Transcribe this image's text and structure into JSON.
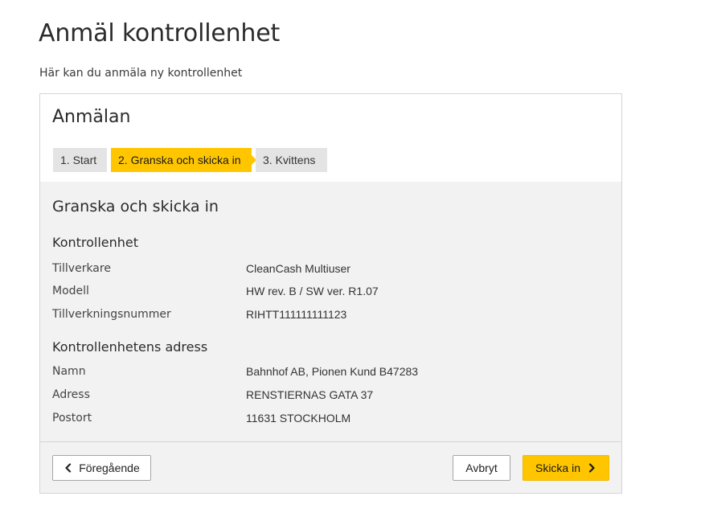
{
  "page": {
    "title": "Anmäl kontrollenhet",
    "intro": "Här kan du anmäla ny kontrollenhet"
  },
  "card": {
    "title": "Anmälan",
    "steps": [
      {
        "label": "1. Start",
        "active": false
      },
      {
        "label": "2. Granska och skicka in",
        "active": true
      },
      {
        "label": "3. Kvittens",
        "active": false
      }
    ]
  },
  "review": {
    "title": "Granska och skicka in",
    "unit": {
      "heading": "Kontrollenhet",
      "rows": [
        {
          "label": "Tillverkare",
          "value": "CleanCash Multiuser"
        },
        {
          "label": "Modell",
          "value": "HW rev. B / SW ver. R1.07"
        },
        {
          "label": "Tillverkningsnummer",
          "value": "RIHTT111111111123"
        }
      ]
    },
    "address": {
      "heading": "Kontrollenhetens adress",
      "rows": [
        {
          "label": "Namn",
          "value": "Bahnhof AB, Pionen Kund B47283"
        },
        {
          "label": "Adress",
          "value": "RENSTIERNAS GATA 37"
        },
        {
          "label": "Postort",
          "value": "11631 STOCKHOLM"
        }
      ]
    }
  },
  "footer": {
    "previous_label": "Föregående",
    "previous_icon": "chevron-left-icon",
    "cancel_label": "Avbryt",
    "submit_label": "Skicka in",
    "submit_icon": "chevron-right-icon"
  },
  "colors": {
    "accent": "#ffc600",
    "step_inactive": "#e4e4e4",
    "section_background": "#f2f2f2"
  }
}
